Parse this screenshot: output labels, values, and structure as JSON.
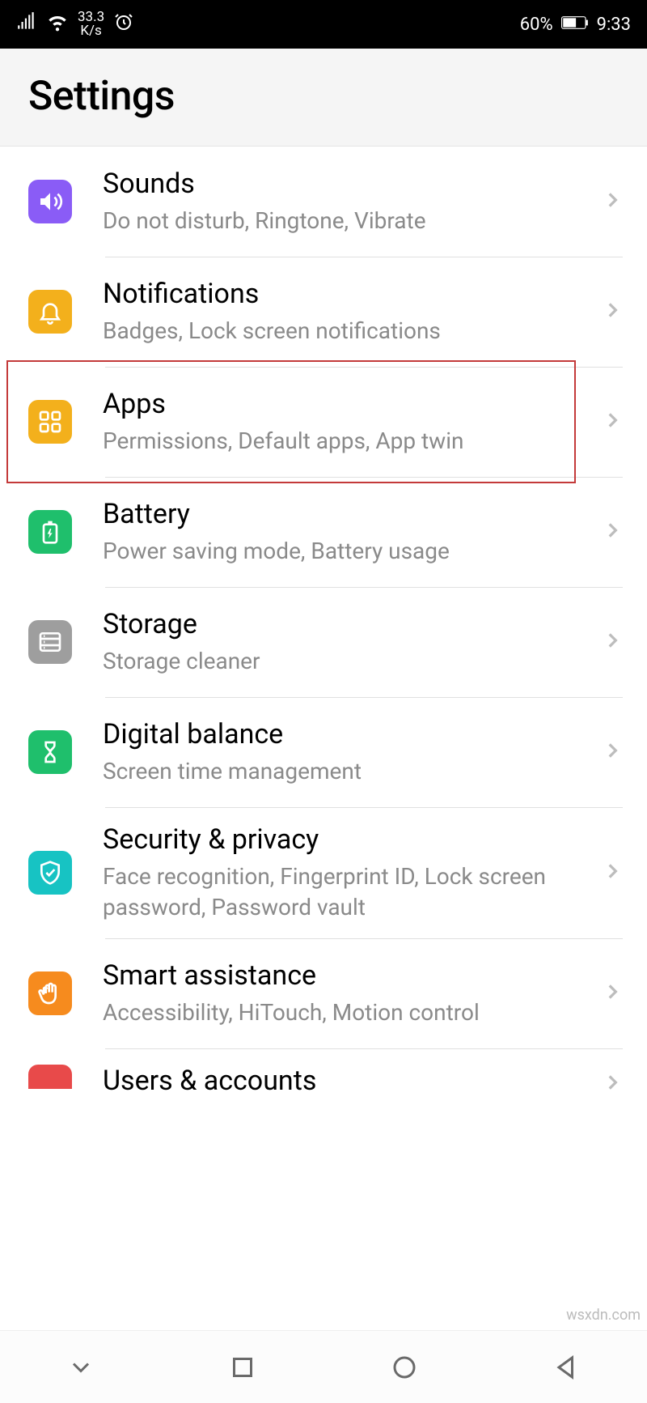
{
  "status": {
    "speed_value": "33.3",
    "speed_unit": "K/s",
    "battery_pct": "60%",
    "time": "9:33"
  },
  "header": {
    "title": "Settings"
  },
  "items": [
    {
      "id": "sounds",
      "title": "Sounds",
      "subtitle": "Do not disturb, Ringtone, Vibrate",
      "color": "c-purple",
      "highlighted": false
    },
    {
      "id": "notifications",
      "title": "Notifications",
      "subtitle": "Badges, Lock screen notifications",
      "color": "c-yellow",
      "highlighted": false
    },
    {
      "id": "apps",
      "title": "Apps",
      "subtitle": "Permissions, Default apps, App twin",
      "color": "c-yellow",
      "highlighted": true
    },
    {
      "id": "battery",
      "title": "Battery",
      "subtitle": "Power saving mode, Battery usage",
      "color": "c-green",
      "highlighted": false
    },
    {
      "id": "storage",
      "title": "Storage",
      "subtitle": "Storage cleaner",
      "color": "c-gray",
      "highlighted": false
    },
    {
      "id": "digital-balance",
      "title": "Digital balance",
      "subtitle": "Screen time management",
      "color": "c-green",
      "highlighted": false
    },
    {
      "id": "security",
      "title": "Security & privacy",
      "subtitle": "Face recognition, Fingerprint ID, Lock screen password, Password vault",
      "color": "c-teal",
      "highlighted": false
    },
    {
      "id": "smart-assistance",
      "title": "Smart assistance",
      "subtitle": "Accessibility, HiTouch, Motion control",
      "color": "c-orange",
      "highlighted": false
    },
    {
      "id": "users-accounts",
      "title": "Users & accounts",
      "subtitle": "",
      "color": "c-red",
      "highlighted": false
    }
  ],
  "watermark": "wsxdn.com"
}
